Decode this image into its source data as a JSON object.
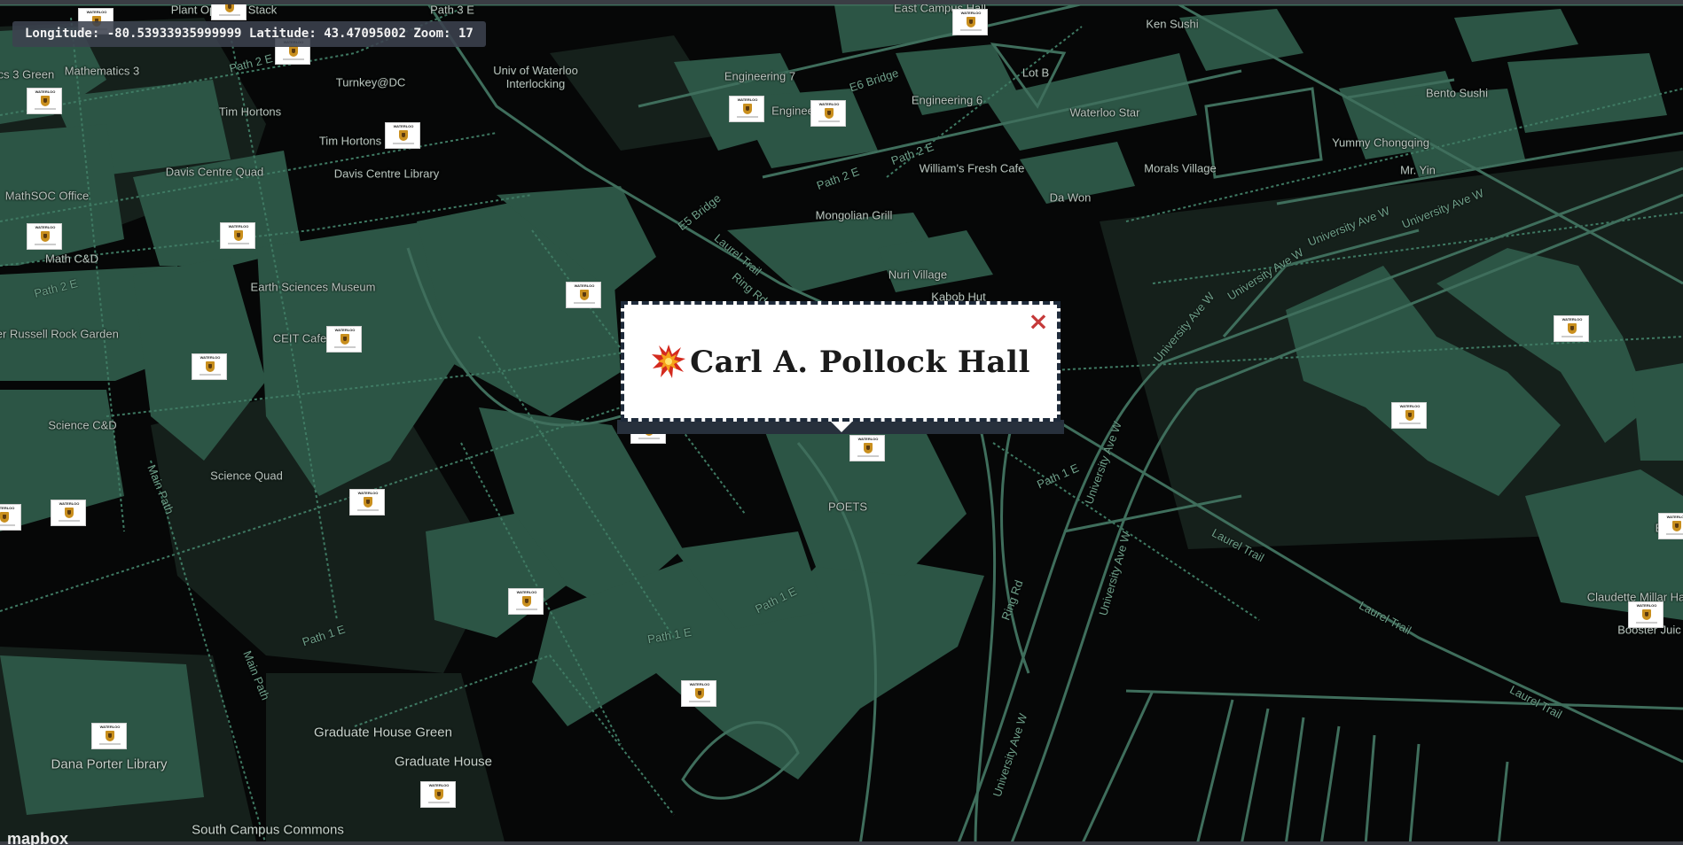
{
  "coordinates": {
    "longitude_label": "Longitude:",
    "longitude_value": "-80.53933935999999",
    "latitude_label": "Latitude:",
    "latitude_value": "43.47095002",
    "zoom_label": "Zoom:",
    "zoom_value": "17"
  },
  "popup": {
    "title": "Carl A. Pollock Hall",
    "close_symbol": "×",
    "icon": "collision-icon"
  },
  "attribution": {
    "logo_text": "mapbox"
  },
  "place_labels": [
    "Plant Op",
    "Stack",
    "Path 3 E",
    "East Campus Hall",
    "Ken Sushi",
    "ics 3 Green",
    "Mathematics 3",
    "Turnkey@DC",
    "Univ of Waterloo Interlocking",
    "Engineering 7",
    "Lot B",
    "Engineering 6",
    "Waterloo Star",
    "Bento Sushi",
    "Tim Hortons",
    "Tim Hortons",
    "Davis Centre Quad",
    "Davis Centre Library",
    "Yummy Chongqing",
    "Mr. Yin",
    "William's Fresh Cafe",
    "Morals Village",
    "MathSOC Office",
    "Da Won",
    "Mongolian Grill",
    "Math C&D",
    "Nuri Village",
    "Kabob Hut",
    "Earth Sciences Museum",
    "CEIT Cafe",
    "ter Russell Rock Garden",
    "Science C&D",
    "Science Quad",
    "POETS",
    "Claudette Millar Ha",
    "Booster Juic",
    "Graduate House Green",
    "Graduate House",
    "Dana Porter Library",
    "South Campus Commons",
    "Enginee",
    "E"
  ],
  "road_labels": [
    "Path 2 E",
    "E6 Bridge",
    "E5 Bridge",
    "Path 2 E",
    "Path 2 E",
    "Laurel Trail",
    "Ring Rd",
    "University Ave W",
    "University Ave W",
    "University Ave W",
    "University Ave W",
    "University Ave W",
    "University Ave W",
    "Path 1 E",
    "Path 1 E",
    "Path 1 E",
    "Path 1 E",
    "Laurel Trail",
    "Laurel Trail",
    "Laurel Trail",
    "Ring Rd",
    "University Ave W",
    "Main Path",
    "Main Path",
    "Path 2 E"
  ],
  "marker_count_label": "",
  "colors": {
    "background": "#060707",
    "building": "#2c5545",
    "path": "#3f7a63",
    "road": "#4d8a72",
    "popup_border": "#1e2a3a",
    "close": "#c53a3a"
  }
}
